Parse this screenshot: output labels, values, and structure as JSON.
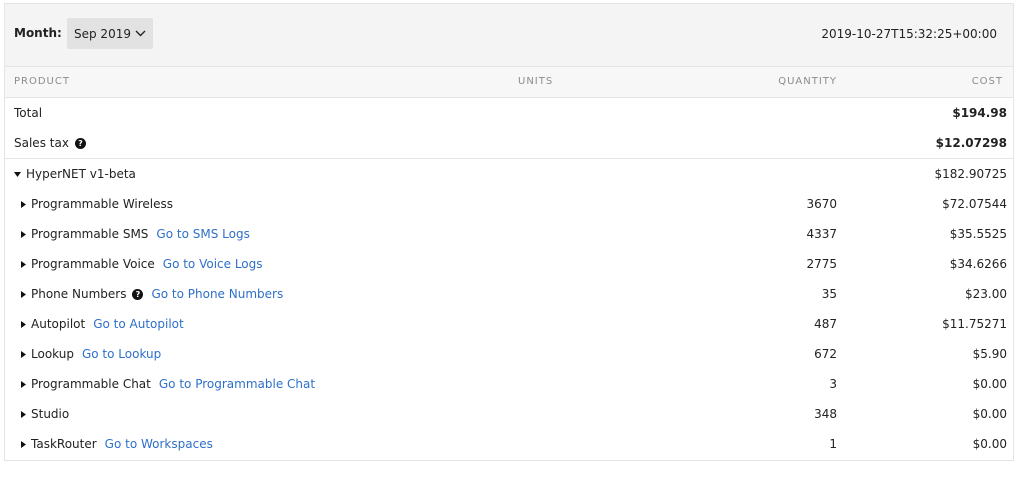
{
  "header": {
    "month_label": "Month:",
    "month_value": "Sep 2019",
    "timestamp": "2019-10-27T15:32:25+00:00"
  },
  "columns": {
    "product": "PRODUCT",
    "units": "UNITS",
    "quantity": "QUANTITY",
    "cost": "COST"
  },
  "summary": {
    "total_label": "Total",
    "total_cost": "$194.98",
    "tax_label": "Sales tax",
    "tax_cost": "$12.07298"
  },
  "group": {
    "name": "HyperNET v1-beta",
    "cost": "$182.90725"
  },
  "items": [
    {
      "name": "Programmable Wireless",
      "link": "",
      "help": false,
      "quantity": "3670",
      "cost": "$72.07544"
    },
    {
      "name": "Programmable SMS",
      "link": "Go to SMS Logs",
      "help": false,
      "quantity": "4337",
      "cost": "$35.5525"
    },
    {
      "name": "Programmable Voice",
      "link": "Go to Voice Logs",
      "help": false,
      "quantity": "2775",
      "cost": "$34.6266"
    },
    {
      "name": "Phone Numbers",
      "link": "Go to Phone Numbers",
      "help": true,
      "quantity": "35",
      "cost": "$23.00"
    },
    {
      "name": "Autopilot",
      "link": "Go to Autopilot",
      "help": false,
      "quantity": "487",
      "cost": "$11.75271"
    },
    {
      "name": "Lookup",
      "link": "Go to Lookup",
      "help": false,
      "quantity": "672",
      "cost": "$5.90"
    },
    {
      "name": "Programmable Chat",
      "link": "Go to Programmable Chat",
      "help": false,
      "quantity": "3",
      "cost": "$0.00"
    },
    {
      "name": "Studio",
      "link": "",
      "help": false,
      "quantity": "348",
      "cost": "$0.00"
    },
    {
      "name": "TaskRouter",
      "link": "Go to Workspaces",
      "help": false,
      "quantity": "1",
      "cost": "$0.00"
    }
  ],
  "icons": {
    "help": "question-circle-icon",
    "expand": "caret-right-icon",
    "collapse": "caret-down-icon",
    "dropdown": "chevron-down-icon"
  },
  "colors": {
    "link": "#2e70c9",
    "header_bg": "#f4f4f4",
    "select_bg": "#e2e2e2"
  }
}
